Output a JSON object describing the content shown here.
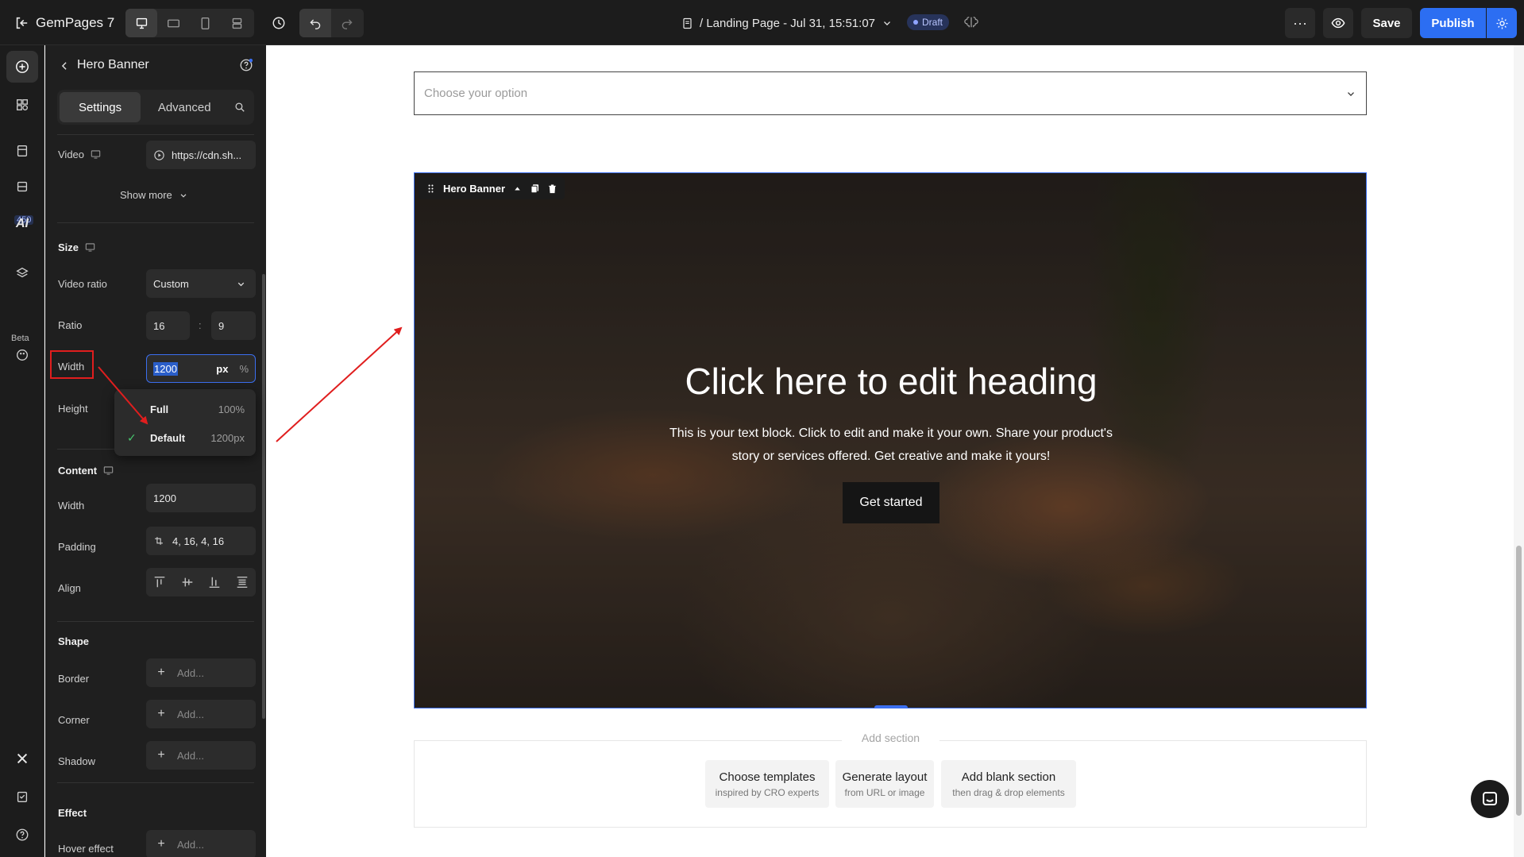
{
  "app": {
    "name": "GemPages 7"
  },
  "topbar": {
    "page_name": "/ Landing Page - Jul 31, 15:51:07",
    "status": "Draft",
    "more_label": "···",
    "save_label": "Save",
    "publish_label": "Publish"
  },
  "rail": {
    "badge": "450",
    "beta": "Beta",
    "ai_label": "AI"
  },
  "panel": {
    "title": "Hero Banner",
    "tabs": {
      "settings": "Settings",
      "advanced": "Advanced"
    },
    "video": {
      "label": "Video",
      "value": "https://cdn.sh..."
    },
    "show_more": "Show more",
    "size": {
      "title": "Size",
      "video_ratio_label": "Video ratio",
      "video_ratio_value": "Custom",
      "ratio_label": "Ratio",
      "ratio_w": "16",
      "ratio_sep": ":",
      "ratio_h": "9",
      "width_label": "Width",
      "width_value": "1200",
      "unit_px": "px",
      "unit_pct": "%",
      "height_label": "Height",
      "width_options": [
        {
          "name": "Full",
          "value": "100%"
        },
        {
          "name": "Default",
          "value": "1200px",
          "selected": true
        }
      ]
    },
    "content": {
      "title": "Content",
      "width_label": "Width",
      "width_value": "1200",
      "padding_label": "Padding",
      "padding_value": "4, 16, 4, 16",
      "align_label": "Align"
    },
    "shape": {
      "title": "Shape",
      "border_label": "Border",
      "corner_label": "Corner",
      "shadow_label": "Shadow",
      "add_placeholder": "Add..."
    },
    "effect": {
      "title": "Effect",
      "hover_label": "Hover effect",
      "add_placeholder": "Add..."
    }
  },
  "canvas": {
    "select_placeholder": "Choose your option",
    "hero": {
      "toolbar_label": "Hero Banner",
      "heading": "Click here to edit heading",
      "text": "This is your text block. Click to edit and make it your own. Share your product's story or services offered. Get creative and make it yours!",
      "cta": "Get started"
    },
    "add_section": {
      "label": "Add section",
      "cards": [
        {
          "title": "Choose templates",
          "sub": "inspired by CRO experts"
        },
        {
          "title": "Generate layout",
          "sub": "from URL or image"
        },
        {
          "title": "Add blank section",
          "sub": "then drag & drop elements"
        }
      ]
    }
  },
  "colors": {
    "accent": "#2c6ef2",
    "annotation_red": "#e01e1e",
    "check_green": "#47c96f"
  }
}
